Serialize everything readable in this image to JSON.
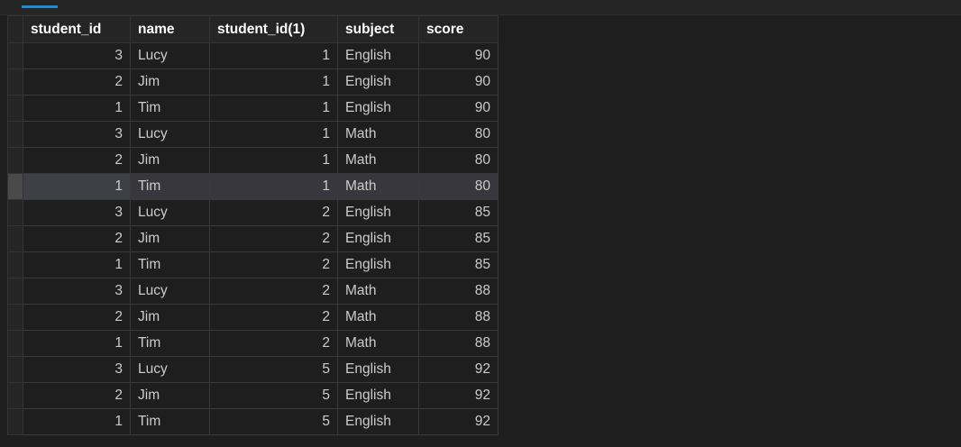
{
  "results": {
    "columns": [
      "student_id",
      "name",
      "student_id(1)",
      "subject",
      "score"
    ],
    "rows": [
      [
        "3",
        "Lucy",
        "1",
        "English",
        "90"
      ],
      [
        "2",
        "Jim",
        "1",
        "English",
        "90"
      ],
      [
        "1",
        "Tim",
        "1",
        "English",
        "90"
      ],
      [
        "3",
        "Lucy",
        "1",
        "Math",
        "80"
      ],
      [
        "2",
        "Jim",
        "1",
        "Math",
        "80"
      ],
      [
        "1",
        "Tim",
        "1",
        "Math",
        "80"
      ],
      [
        "3",
        "Lucy",
        "2",
        "English",
        "85"
      ],
      [
        "2",
        "Jim",
        "2",
        "English",
        "85"
      ],
      [
        "1",
        "Tim",
        "2",
        "English",
        "85"
      ],
      [
        "3",
        "Lucy",
        "2",
        "Math",
        "88"
      ],
      [
        "2",
        "Jim",
        "2",
        "Math",
        "88"
      ],
      [
        "1",
        "Tim",
        "2",
        "Math",
        "88"
      ],
      [
        "3",
        "Lucy",
        "5",
        "English",
        "92"
      ],
      [
        "2",
        "Jim",
        "5",
        "English",
        "92"
      ],
      [
        "1",
        "Tim",
        "5",
        "English",
        "92"
      ]
    ],
    "selected_row": 5
  },
  "colors": {
    "accent": "#1f8ad2",
    "background": "#1e1e1e",
    "selected_row": "#37373d"
  }
}
